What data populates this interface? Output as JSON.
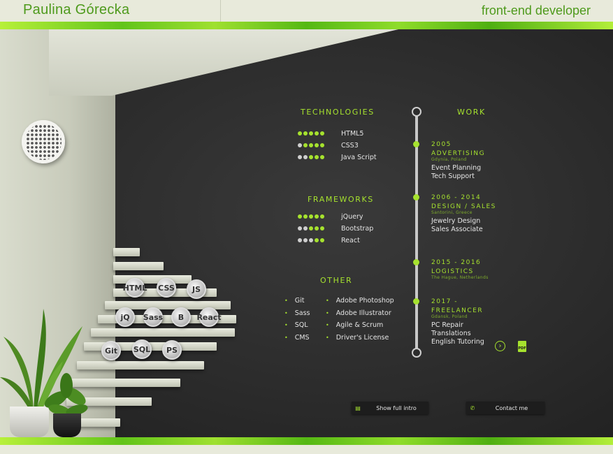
{
  "header": {
    "name": "Paulina Górecka",
    "role": "front-end developer"
  },
  "technologies": {
    "title": "TECHNOLOGIES",
    "items": [
      {
        "name": "HTML5",
        "level": 5
      },
      {
        "name": "CSS3",
        "level": 4
      },
      {
        "name": "Java Script",
        "level": 3
      }
    ]
  },
  "frameworks": {
    "title": "FRAMEWORKS",
    "items": [
      {
        "name": "jQuery",
        "level": 5
      },
      {
        "name": "Bootstrap",
        "level": 3
      },
      {
        "name": "React",
        "level": 2
      }
    ]
  },
  "other": {
    "title": "OTHER",
    "left": [
      "Git",
      "Sass",
      "SQL",
      "CMS"
    ],
    "right": [
      "Adobe Photoshop",
      "Adobe Illustrator",
      "Agile & Scrum",
      "Driver's License"
    ]
  },
  "work": {
    "title": "WORK",
    "entries": [
      {
        "years": "2005",
        "field": "ADVERTISING",
        "place": "Gdynia, Poland",
        "tasks": [
          "Event Planning",
          "Tech Support"
        ]
      },
      {
        "years": "2006 - 2014",
        "field": "DESIGN / SALES",
        "place": "Santorini, Greece",
        "tasks": [
          "Jewelry Design",
          "Sales Associate"
        ]
      },
      {
        "years": "2015 - 2016",
        "field": "LOGISTICS",
        "place": "The Hague, Netherlands",
        "tasks": []
      },
      {
        "years": "2017 -",
        "field": "FREELANCER",
        "place": "Gdansk, Poland",
        "tasks": [
          "PC Repair",
          "Translations",
          "English Tutoring"
        ]
      }
    ]
  },
  "skill_icons": [
    "HTML",
    "CSS",
    "JS",
    "jQ",
    "Sass",
    "B",
    "React",
    "Git",
    "SQL",
    "PS"
  ],
  "buttons": {
    "intro": "Show full intro",
    "contact": "Contact me"
  },
  "icons": {
    "pdf": "PDF",
    "next": "›"
  },
  "colors": {
    "accent": "#a6e22e",
    "brand": "#4e9a1c"
  }
}
